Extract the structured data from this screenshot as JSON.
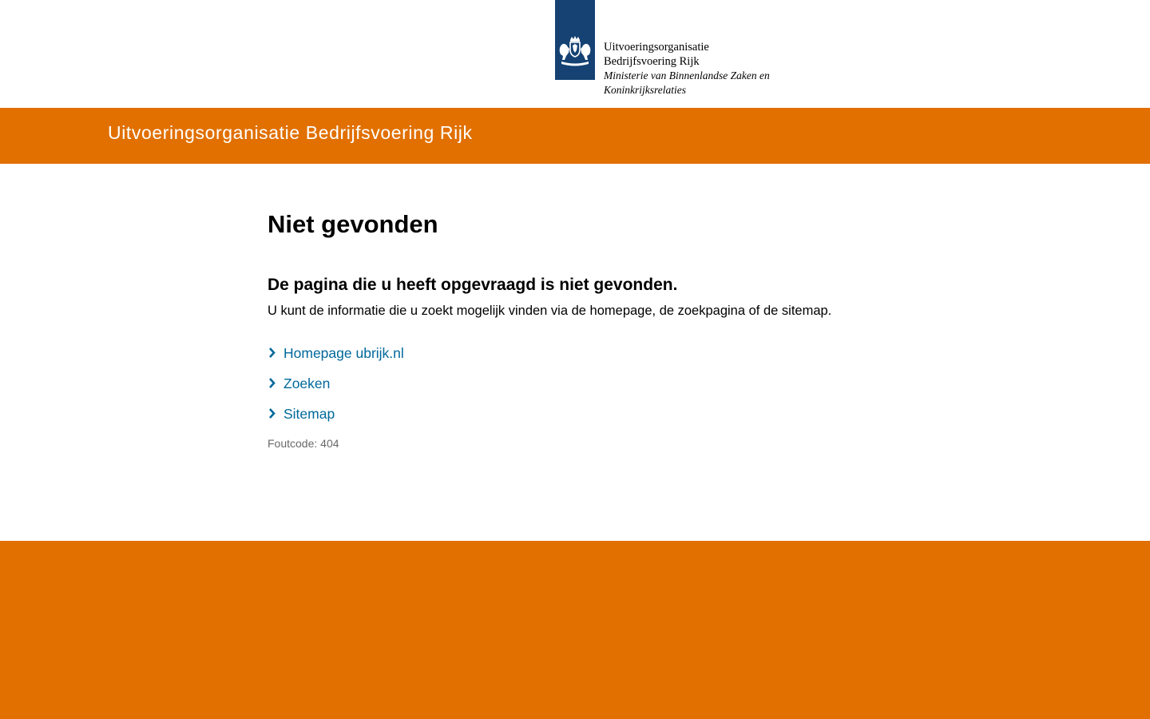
{
  "logo": {
    "icon": "coat-of-arms-icon",
    "line1": "Uitvoeringsorganisatie",
    "line2": "Bedrijfsvoering Rijk",
    "line3": "Ministerie van Binnenlandse Zaken en",
    "line4": "Koninkrijksrelaties"
  },
  "header": {
    "site_title": "Uitvoeringsorganisatie Bedrijfsvoering Rijk"
  },
  "main": {
    "title": "Niet gevonden",
    "subheading": "De pagina die u heeft opgevraagd is niet gevonden.",
    "intro": "U kunt de informatie die u zoekt mogelijk vinden via de homepage, de zoekpagina of de sitemap.",
    "links": [
      {
        "label": "Homepage ubrijk.nl",
        "icon": "chevron-right-icon"
      },
      {
        "label": "Zoeken",
        "icon": "chevron-right-icon"
      },
      {
        "label": "Sitemap",
        "icon": "chevron-right-icon"
      }
    ],
    "error_code": "Foutcode: 404"
  },
  "colors": {
    "brand_orange": "#e17000",
    "logo_blue": "#154273",
    "link_blue": "#01689b",
    "muted_text": "#696969"
  }
}
